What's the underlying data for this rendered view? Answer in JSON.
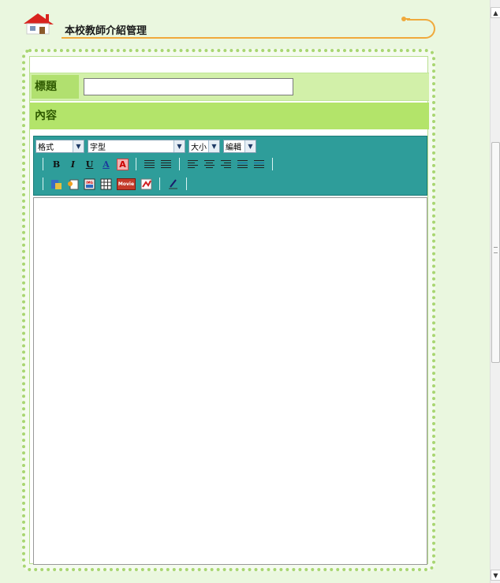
{
  "header": {
    "title": "本校教師介紹管理"
  },
  "form": {
    "title_label": "標題",
    "title_value": "",
    "content_label": "內容"
  },
  "toolbar": {
    "format_select": "格式",
    "font_select": "字型",
    "size_select": "大小",
    "edit_select": "編輯",
    "bold": "B",
    "italic": "I",
    "underline": "U",
    "font_color": "A",
    "highlight": "A",
    "image_btn": "IMG",
    "movie_btn": "Movie"
  },
  "colors": {
    "background": "#eaf7df",
    "accent_orange": "#f0a93c",
    "label_green": "#b1e06f",
    "toolbar_teal": "#2e9d9a"
  }
}
